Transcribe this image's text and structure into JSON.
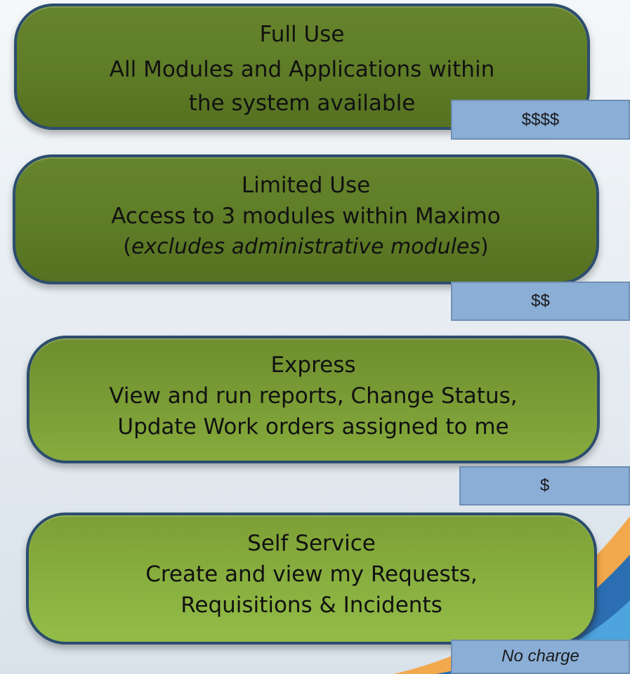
{
  "tiers": [
    {
      "title": "Full Use",
      "desc_1": "All Modules and Applications within",
      "desc_2": "the system available",
      "price": "$$$$"
    },
    {
      "title": "Limited Use",
      "desc_1": "Access to 3 modules within Maximo",
      "paren_open": "(",
      "desc_italic": "excludes administrative modules",
      "paren_close": ")",
      "price": "$$"
    },
    {
      "title": "Express",
      "desc_1": "View and run reports, Change Status,",
      "desc_2": "Update Work orders assigned to me",
      "price": "$"
    },
    {
      "title": "Self Service",
      "desc_1": "Create and view my Requests,",
      "desc_2": "Requisitions & Incidents",
      "price": "No charge"
    }
  ],
  "colors": {
    "tier_border": "#2c4d6e",
    "tier_fill_dark": "#5f7c27",
    "tier_fill_light": "#89b040",
    "price_fill": "#8aaed6",
    "wave_orange": "#f2a84d",
    "wave_blue": "#2b6fb2"
  }
}
